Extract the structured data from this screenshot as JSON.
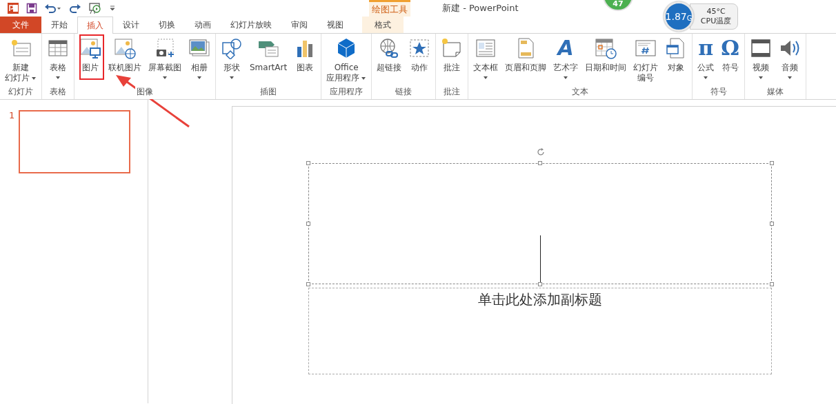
{
  "window": {
    "title": "新建 - PowerPoint"
  },
  "context_tab_group": {
    "label": "绘图工具"
  },
  "tabs": [
    {
      "label": "文件",
      "kind": "file",
      "selected": false
    },
    {
      "label": "开始",
      "kind": "normal",
      "selected": false
    },
    {
      "label": "插入",
      "kind": "normal",
      "selected": true
    },
    {
      "label": "设计",
      "kind": "normal",
      "selected": false
    },
    {
      "label": "切换",
      "kind": "normal",
      "selected": false
    },
    {
      "label": "动画",
      "kind": "normal",
      "selected": false
    },
    {
      "label": "幻灯片放映",
      "kind": "normal",
      "selected": false
    },
    {
      "label": "审阅",
      "kind": "normal",
      "selected": false
    },
    {
      "label": "视图",
      "kind": "normal",
      "selected": false
    },
    {
      "label": "格式",
      "kind": "contextual",
      "selected": false
    }
  ],
  "system_widgets": {
    "badge": "47",
    "memory": {
      "value": "1.87",
      "unit": "G"
    },
    "cpu": {
      "temperature": "45°C",
      "label": "CPU温度"
    }
  },
  "ribbon_groups": [
    {
      "label": "幻灯片",
      "buttons": [
        {
          "kind": "new-slide",
          "lines": [
            "新建",
            "幻灯片"
          ],
          "dropdown": true
        }
      ]
    },
    {
      "label": "表格",
      "buttons": [
        {
          "kind": "table",
          "lines": [
            "表格"
          ],
          "dropdown": true
        }
      ]
    },
    {
      "label": "图像",
      "buttons": [
        {
          "kind": "picture",
          "lines": [
            "图片"
          ],
          "dropdown": false
        },
        {
          "kind": "online-picture",
          "lines": [
            "联机图片"
          ],
          "dropdown": false
        },
        {
          "kind": "screenshot",
          "lines": [
            "屏幕截图"
          ],
          "dropdown": true
        },
        {
          "kind": "album",
          "lines": [
            "相册"
          ],
          "dropdown": true
        }
      ]
    },
    {
      "label": "插图",
      "buttons": [
        {
          "kind": "shapes",
          "lines": [
            "形状"
          ],
          "dropdown": true
        },
        {
          "kind": "smartart",
          "lines": [
            "SmartArt"
          ],
          "dropdown": false
        },
        {
          "kind": "chart",
          "lines": [
            "图表"
          ],
          "dropdown": false
        }
      ]
    },
    {
      "label": "应用程序",
      "buttons": [
        {
          "kind": "office",
          "lines": [
            "Office",
            "应用程序"
          ],
          "dropdown": true
        }
      ]
    },
    {
      "label": "链接",
      "buttons": [
        {
          "kind": "hyperlink",
          "lines": [
            "超链接"
          ],
          "dropdown": false
        },
        {
          "kind": "action",
          "lines": [
            "动作"
          ],
          "dropdown": false
        }
      ]
    },
    {
      "label": "批注",
      "buttons": [
        {
          "kind": "comment",
          "lines": [
            "批注"
          ],
          "dropdown": false
        }
      ]
    },
    {
      "label": "文本",
      "buttons": [
        {
          "kind": "textbox",
          "lines": [
            "文本框"
          ],
          "dropdown": true
        },
        {
          "kind": "header-footer",
          "lines": [
            "页眉和页脚"
          ],
          "dropdown": false
        },
        {
          "kind": "wordart",
          "glyph": "A",
          "lines": [
            "艺术字"
          ],
          "dropdown": true
        },
        {
          "kind": "datetime",
          "lines": [
            "日期和时间"
          ],
          "dropdown": false
        },
        {
          "kind": "slide-number",
          "lines": [
            "幻灯片",
            "编号"
          ],
          "dropdown": false
        },
        {
          "kind": "object",
          "lines": [
            "对象"
          ],
          "dropdown": false
        }
      ]
    },
    {
      "label": "符号",
      "buttons": [
        {
          "kind": "equation",
          "glyph": "π",
          "lines": [
            "公式"
          ],
          "dropdown": true
        },
        {
          "kind": "symbol",
          "glyph": "Ω",
          "lines": [
            "符号"
          ],
          "dropdown": false
        }
      ]
    },
    {
      "label": "媒体",
      "buttons": [
        {
          "kind": "video",
          "lines": [
            "视频"
          ],
          "dropdown": true
        },
        {
          "kind": "audio",
          "lines": [
            "音频"
          ],
          "dropdown": true
        }
      ]
    }
  ],
  "slide_thumbnails": [
    {
      "number": "1",
      "selected": true
    }
  ],
  "slide": {
    "placeholders": [
      {
        "kind": "title",
        "selected": true
      },
      {
        "kind": "subtitle",
        "placeholder": "单击此处添加副标题",
        "selected": false
      }
    ]
  }
}
